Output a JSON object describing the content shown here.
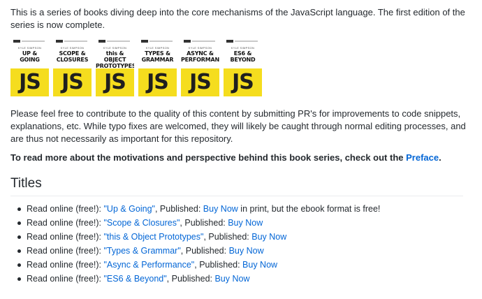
{
  "intro": "This is a series of books diving deep into the core mechanisms of the JavaScript language. The first edition of the series is now complete.",
  "covers": [
    {
      "author": "KYLE SIMPSON",
      "title": "UP &\nGOING",
      "logo": "JS"
    },
    {
      "author": "KYLE SIMPSON",
      "title": "SCOPE &\nCLOSURES",
      "logo": "JS"
    },
    {
      "author": "KYLE SIMPSON",
      "title": "this & OBJECT\nPROTOTYPES",
      "logo": "JS"
    },
    {
      "author": "KYLE SIMPSON",
      "title": "TYPES &\nGRAMMAR",
      "logo": "JS"
    },
    {
      "author": "KYLE SIMPSON",
      "title": "ASYNC &\nPERFORMANCE",
      "logo": "JS"
    },
    {
      "author": "KYLE SIMPSON",
      "title": "ES6 &\nBEYOND",
      "logo": "JS"
    }
  ],
  "contribute": "Please feel free to contribute to the quality of this content by submitting PR's for improvements to code snippets, explanations, etc. While typo fixes are welcomed, they will likely be caught through normal editing processes, and are thus not necessarily as important for this repository.",
  "motivation": {
    "text": "To read more about the motivations and perspective behind this book series, check out the ",
    "link": "Preface",
    "end": "."
  },
  "titles_heading": "Titles",
  "titles": [
    {
      "prefix": "Read online (free!): ",
      "title": "\"Up & Going\"",
      "mid": ", Published: ",
      "buy": "Buy Now",
      "suffix": " in print, but the ebook format is free!"
    },
    {
      "prefix": "Read online (free!): ",
      "title": "\"Scope & Closures\"",
      "mid": ", Published: ",
      "buy": "Buy Now",
      "suffix": ""
    },
    {
      "prefix": "Read online (free!): ",
      "title": "\"this & Object Prototypes\"",
      "mid": ", Published: ",
      "buy": "Buy Now",
      "suffix": ""
    },
    {
      "prefix": "Read online (free!): ",
      "title": "\"Types & Grammar\"",
      "mid": ", Published: ",
      "buy": "Buy Now",
      "suffix": ""
    },
    {
      "prefix": "Read online (free!): ",
      "title": "\"Async & Performance\"",
      "mid": ", Published: ",
      "buy": "Buy Now",
      "suffix": ""
    },
    {
      "prefix": "Read online (free!): ",
      "title": "\"ES6 & Beyond\"",
      "mid": ", Published: ",
      "buy": "Buy Now",
      "suffix": ""
    }
  ],
  "colors": {
    "link": "#0366d6",
    "text": "#24292e",
    "cover_yellow": "#f5dd1e"
  }
}
